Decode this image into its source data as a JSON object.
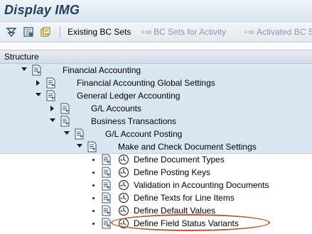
{
  "window": {
    "title": "Display IMG"
  },
  "toolbar": {
    "existing_bc_sets": "Existing BC Sets",
    "bc_sets_for_activity": "BC Sets for Activity",
    "activated_bc_sets": "Activated BC S"
  },
  "structure": {
    "header": "Structure"
  },
  "tree": {
    "financial_accounting": "Financial Accounting",
    "fa_global_settings": "Financial Accounting Global Settings",
    "gl_accounting": "General Ledger Accounting",
    "gl_accounts": "G/L Accounts",
    "business_transactions": "Business Transactions",
    "gl_account_posting": "G/L Account Posting",
    "make_check_doc_settings": "Make and Check Document Settings",
    "define_document_types": "Define Document Types",
    "define_posting_keys": "Define Posting Keys",
    "validation_accounting_documents": "Validation in Accounting Documents",
    "define_texts_line_items": "Define Texts for Line Items",
    "define_default_values": "Define Default Values",
    "define_field_status_variants": "Define Field Status Variants"
  },
  "colors": {
    "title": "#1f3e62",
    "row_shade": "#d9e7f2",
    "highlight": "#b45b2c"
  }
}
